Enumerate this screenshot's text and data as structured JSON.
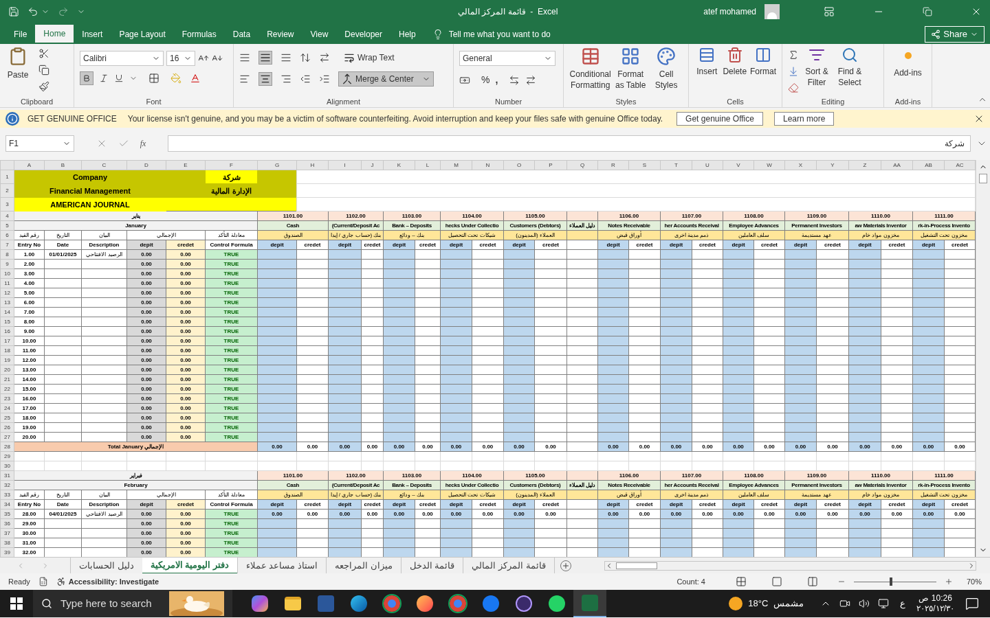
{
  "window": {
    "title": "قائمة المركز المالي  -  Excel",
    "user": "atef mohamed"
  },
  "menu": [
    {
      "label": "File",
      "selected": false
    },
    {
      "label": "Home",
      "selected": true
    },
    {
      "label": "Insert",
      "selected": false
    },
    {
      "label": "Page Layout",
      "selected": false
    },
    {
      "label": "Formulas",
      "selected": false
    },
    {
      "label": "Data",
      "selected": false
    },
    {
      "label": "Review",
      "selected": false
    },
    {
      "label": "View",
      "selected": false
    },
    {
      "label": "Developer",
      "selected": false
    },
    {
      "label": "Help",
      "selected": false
    }
  ],
  "tell_me": "Tell me what you want to do",
  "share": "Share",
  "ribbon": {
    "clipboard": {
      "paste": "Paste",
      "label": "Clipboard"
    },
    "font": {
      "family": "Calibri",
      "size": "16",
      "label": "Font"
    },
    "alignment": {
      "wrap": "Wrap Text",
      "merge": "Merge & Center",
      "label": "Alignment"
    },
    "number": {
      "format": "General",
      "percent": "%",
      "comma": ",",
      "label": "Number"
    },
    "styles": {
      "buttons": [
        "Conditional Formatting",
        "Format as Table",
        "Cell Styles"
      ],
      "label": "Styles"
    },
    "cells": {
      "buttons": [
        "Insert",
        "Delete",
        "Format"
      ],
      "label": "Cells"
    },
    "editing": {
      "buttons": [
        "Sort & Filter",
        "Find & Select"
      ],
      "label": "Editing"
    },
    "addins": {
      "button": "Add-ins",
      "label": "Add-ins"
    }
  },
  "notice": {
    "title": "GET GENUINE OFFICE",
    "message": "Your license isn't genuine, and you may be a victim of software counterfeiting. Avoid interruption and keep your files safe with genuine Office today.",
    "buttons": [
      "Get genuine Office",
      "Learn more"
    ]
  },
  "formula_bar": {
    "name_box": "F1",
    "fx": "fx",
    "content": "شركة"
  },
  "sheet": {
    "columns": [
      "A",
      "B",
      "C",
      "D",
      "E",
      "F",
      "G",
      "H",
      "I",
      "J",
      "K",
      "L",
      "M",
      "N",
      "O",
      "P",
      "Q",
      "R",
      "S",
      "T",
      "U",
      "V",
      "W",
      "X",
      "Y",
      "Z",
      "AA",
      "AB",
      "AC"
    ],
    "row_headers": [
      "1",
      "2",
      "3",
      "4",
      "5",
      "6",
      "7",
      "8",
      "9",
      "10",
      "11",
      "12",
      "13",
      "14",
      "15",
      "16",
      "17",
      "18",
      "19",
      "20",
      "21",
      "22",
      "23",
      "24",
      "25",
      "26",
      "27",
      "28",
      "29",
      "30",
      "31",
      "32",
      "33",
      "34",
      "35",
      "36",
      "37",
      "38",
      "39"
    ],
    "sections": [
      {
        "kind": "title",
        "company_en": "Company",
        "company_ar": "شركة",
        "dept_en": "Financial Management",
        "dept_ar": "الإدارة المالية",
        "journal": "AMERICAN JOURNAL"
      },
      {
        "kind": "month",
        "month_ar": "يناير",
        "month_en": "January",
        "heads_ar": [
          "معادلة التأكد",
          "الإجمالي",
          "البيان",
          "التاريخ",
          "رقم القيد"
        ],
        "heads": [
          {
            "en": "Entry No"
          },
          {
            "en": "Date"
          },
          {
            "en": "Description"
          },
          {
            "en_debit": "depit",
            "en_credit": "credet"
          },
          {
            "en": "Control Formula"
          }
        ],
        "names_ar": [
          "مخزون تحت التشغيل",
          "مخزون مواد خام",
          "عهد مستديمة",
          "سلف العاملين",
          "ذمم مدينة اخرى",
          "أوراق قبض",
          "العملاء (المدينون)",
          "شيكات تحت التحصيل",
          "بنك – ودائع",
          "بنك (حساب جاري / إيدا",
          "الصندوق"
        ],
        "accounts": [
          {
            "kind": "pair",
            "code": "1101.00",
            "name_en": "Cash",
            "labels": [
              "depit",
              "credet"
            ]
          },
          {
            "kind": "pair",
            "code": "1102.00",
            "name_en": "(Current/Deposit Ac",
            "labels": [
              "depit",
              "credet"
            ]
          },
          {
            "kind": "pair",
            "code": "1103.00",
            "name_en": "Bank – Deposits",
            "labels": [
              "depit",
              "credet"
            ]
          },
          {
            "kind": "pair",
            "code": "1104.00",
            "name_en": "hecks Under Collectio",
            "labels": [
              "depit",
              "credet"
            ]
          },
          {
            "kind": "pair",
            "code": "1105.00",
            "name_en": "Customers (Debtors)",
            "labels": [
              "depit",
              "credet"
            ]
          },
          {
            "kind": "single",
            "name_en": "دليل العملاء"
          },
          {
            "kind": "pair",
            "code": "1106.00",
            "name_en": "Notes Receivable",
            "labels": [
              "depit",
              "credet"
            ]
          },
          {
            "kind": "pair",
            "code": "1107.00",
            "name_en": "her Accounts Receival",
            "labels": [
              "depit",
              "credet"
            ]
          },
          {
            "kind": "pair",
            "code": "1108.00",
            "name_en": "Employee Advances",
            "labels": [
              "depit",
              "credet"
            ]
          },
          {
            "kind": "pair",
            "code": "1109.00",
            "name_en": "Permanent Investors",
            "labels": [
              "depit",
              "credet"
            ]
          },
          {
            "kind": "pair",
            "code": "1110.00",
            "name_en": "aw Materials Inventor",
            "labels": [
              "depit",
              "credet"
            ]
          },
          {
            "kind": "pair",
            "code": "1111.00",
            "name_en": "rk-in-Process Invento",
            "labels": [
              "depit",
              "credet"
            ]
          }
        ],
        "entries": [
          {
            "no": "1.00",
            "date": "01/01/2025",
            "description": "الرصيد الافتتاحي",
            "debit": "0.00",
            "credit": "0.00",
            "check": "TRUE"
          },
          {
            "no": "2.00",
            "debit": "0.00",
            "credit": "0.00",
            "check": "TRUE"
          },
          {
            "no": "3.00",
            "debit": "0.00",
            "credit": "0.00",
            "check": "TRUE"
          },
          {
            "no": "4.00",
            "debit": "0.00",
            "credit": "0.00",
            "check": "TRUE"
          },
          {
            "no": "5.00",
            "debit": "0.00",
            "credit": "0.00",
            "check": "TRUE"
          },
          {
            "no": "6.00",
            "debit": "0.00",
            "credit": "0.00",
            "check": "TRUE"
          },
          {
            "no": "7.00",
            "debit": "0.00",
            "credit": "0.00",
            "check": "TRUE"
          },
          {
            "no": "8.00",
            "debit": "0.00",
            "credit": "0.00",
            "check": "TRUE"
          },
          {
            "no": "9.00",
            "debit": "0.00",
            "credit": "0.00",
            "check": "TRUE"
          },
          {
            "no": "10.00",
            "debit": "0.00",
            "credit": "0.00",
            "check": "TRUE"
          },
          {
            "no": "11.00",
            "debit": "0.00",
            "credit": "0.00",
            "check": "TRUE"
          },
          {
            "no": "12.00",
            "debit": "0.00",
            "credit": "0.00",
            "check": "TRUE"
          },
          {
            "no": "13.00",
            "debit": "0.00",
            "credit": "0.00",
            "check": "TRUE"
          },
          {
            "no": "14.00",
            "debit": "0.00",
            "credit": "0.00",
            "check": "TRUE"
          },
          {
            "no": "15.00",
            "debit": "0.00",
            "credit": "0.00",
            "check": "TRUE"
          },
          {
            "no": "16.00",
            "debit": "0.00",
            "credit": "0.00",
            "check": "TRUE"
          },
          {
            "no": "17.00",
            "debit": "0.00",
            "credit": "0.00",
            "check": "TRUE"
          },
          {
            "no": "18.00",
            "debit": "0.00",
            "credit": "0.00",
            "check": "TRUE"
          },
          {
            "no": "19.00",
            "debit": "0.00",
            "credit": "0.00",
            "check": "TRUE"
          },
          {
            "no": "20.00",
            "debit": "0.00",
            "credit": "0.00",
            "check": "TRUE"
          }
        ],
        "total": {
          "label": "Total January الإجمالي",
          "values": [
            [
              "0.00",
              "0.00"
            ],
            [
              "0.00",
              "0.00"
            ],
            [
              "0.00",
              "0.00"
            ],
            [
              "0.00",
              "0.00"
            ],
            [
              "0.00",
              "0.00"
            ],
            [
              "0.00",
              "0.00"
            ],
            [
              "0.00",
              "0.00"
            ],
            [
              "0.00",
              "0.00"
            ],
            [
              "0.00",
              "0.00"
            ],
            [
              "0.00",
              "0.00"
            ],
            [
              "0.00",
              "0.00"
            ]
          ]
        }
      },
      {
        "kind": "blank"
      },
      {
        "kind": "blank"
      },
      {
        "kind": "month",
        "month_ar": "فبراير",
        "month_en": "February",
        "heads_ar": [
          "معادلة التأكد",
          "الإجمالي",
          "البيان",
          "التاريخ",
          "رقم القيد"
        ],
        "heads": [
          {
            "en": "Entry No"
          },
          {
            "en": "Date"
          },
          {
            "en": "Description"
          },
          {
            "en_debit": "depit",
            "en_credit": "credet"
          },
          {
            "en": "Control Formula"
          }
        ],
        "names_ar": [
          "مخزون تحت التشغيل",
          "مخزون مواد خام",
          "عهد مستديمة",
          "سلف العاملين",
          "ذمم مدينة اخرى",
          "أوراق قبض",
          "العملاء (المدينون)",
          "شيكات تحت التحصيل",
          "بنك – ودائع",
          "بنك (حساب جاري / إيدا",
          "الصندوق"
        ],
        "accounts": [
          {
            "kind": "pair",
            "code": "1101.00",
            "name_en": "Cash",
            "labels": [
              "depit",
              "credet"
            ]
          },
          {
            "kind": "pair",
            "code": "1102.00",
            "name_en": "(Current/Deposit Ac",
            "labels": [
              "depit",
              "credet"
            ]
          },
          {
            "kind": "pair",
            "code": "1103.00",
            "name_en": "Bank – Deposits",
            "labels": [
              "depit",
              "credet"
            ]
          },
          {
            "kind": "pair",
            "code": "1104.00",
            "name_en": "hecks Under Collectio",
            "labels": [
              "depit",
              "credet"
            ]
          },
          {
            "kind": "pair",
            "code": "1105.00",
            "name_en": "Customers (Debtors)",
            "labels": [
              "depit",
              "credet"
            ]
          },
          {
            "kind": "single",
            "name_en": "دليل العملاء"
          },
          {
            "kind": "pair",
            "code": "1106.00",
            "name_en": "Notes Receivable",
            "labels": [
              "depit",
              "credet"
            ]
          },
          {
            "kind": "pair",
            "code": "1107.00",
            "name_en": "her Accounts Receival",
            "labels": [
              "depit",
              "credet"
            ]
          },
          {
            "kind": "pair",
            "code": "1108.00",
            "name_en": "Employee Advances",
            "labels": [
              "depit",
              "credet"
            ]
          },
          {
            "kind": "pair",
            "code": "1109.00",
            "name_en": "Permanent Investors",
            "labels": [
              "depit",
              "credet"
            ]
          },
          {
            "kind": "pair",
            "code": "1110.00",
            "name_en": "aw Materials Inventor",
            "labels": [
              "depit",
              "credet"
            ]
          },
          {
            "kind": "pair",
            "code": "1111.00",
            "name_en": "rk-in-Process Invento",
            "labels": [
              "depit",
              "credet"
            ]
          }
        ],
        "entries": [
          {
            "no": "28.00",
            "date": "04/01/2025",
            "description": "الرصيد الافتتاحي",
            "debit": "0.00",
            "credit": "0.00",
            "check": "TRUE",
            "values": [
              [
                "0.00",
                "0.00"
              ],
              [
                "0.00",
                "0.00"
              ],
              [
                "0.00",
                "0.00"
              ],
              [
                "0.00",
                "0.00"
              ],
              [
                "0.00",
                "0.00"
              ],
              [
                "0.00",
                "0.00"
              ],
              [
                "0.00",
                "0.00"
              ],
              [
                "0.00",
                "0.00"
              ],
              [
                "0.00",
                "0.00"
              ],
              [
                "0.00",
                "0.00"
              ],
              [
                "0.00",
                "0.00"
              ]
            ]
          },
          {
            "no": "29.00",
            "debit": "0.00",
            "credit": "0.00",
            "check": "TRUE"
          },
          {
            "no": "30.00",
            "debit": "0.00",
            "credit": "0.00",
            "check": "TRUE"
          },
          {
            "no": "31.00",
            "debit": "0.00",
            "credit": "0.00",
            "check": "TRUE"
          },
          {
            "no": "32.00",
            "debit": "0.00",
            "credit": "0.00",
            "check": "TRUE"
          }
        ]
      }
    ]
  },
  "sheet_tabs": [
    {
      "label": "قائمة المركز المالي",
      "selected": false
    },
    {
      "label": "قائمة الدخل",
      "selected": false
    },
    {
      "label": "ميزان المراجعه",
      "selected": false
    },
    {
      "label": "استاذ مساعد عملاء",
      "selected": false
    },
    {
      "label": "دفتر اليومية الامريكية",
      "selected": true
    },
    {
      "label": "دليل الحسابات",
      "selected": false
    }
  ],
  "status_bar": {
    "mode": "Ready",
    "accessibility": "Accessibility: Investigate",
    "count": "Count: 4",
    "zoom": "70%",
    "level": 0.45
  },
  "taskbar": {
    "search_placeholder": "Type here to search",
    "apps": [
      {
        "kind": "copilot",
        "selected": false
      },
      {
        "kind": "folder",
        "selected": false
      },
      {
        "kind": "word",
        "selected": false
      },
      {
        "kind": "edge",
        "selected": false
      },
      {
        "kind": "chrome",
        "selected": false
      },
      {
        "kind": "firefox",
        "selected": false
      },
      {
        "kind": "chrome",
        "selected": false
      },
      {
        "kind": "facebook",
        "selected": false
      },
      {
        "kind": "media",
        "selected": false
      },
      {
        "kind": "whatsapp",
        "selected": false
      },
      {
        "kind": "excel",
        "selected": true
      }
    ],
    "temperature": "18°C",
    "weather": "مشمس",
    "language": "ع",
    "time": "10:26 ص",
    "date": "٢٠٢٥/١٢/٣٠"
  }
}
